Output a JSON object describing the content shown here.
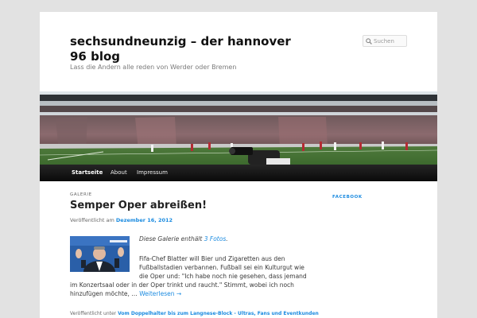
{
  "site": {
    "title": "sechsundneunzig – der hannover 96 blog",
    "description": "Lass die Andern alle reden von Werder oder Bremen"
  },
  "search": {
    "placeholder": "Suchen"
  },
  "nav": {
    "items": [
      {
        "label": "Startseite",
        "active": true
      },
      {
        "label": "About"
      },
      {
        "label": "Impressum"
      }
    ]
  },
  "post": {
    "category": "Galerie",
    "title": "Semper Oper abreißen!",
    "meta_prefix": "Veröffentlicht am",
    "date": "Dezember 16, 2012",
    "gallery_prefix": "Diese Galerie enthält",
    "gallery_link": "3 Fotos",
    "gallery_suffix": ".",
    "excerpt_lines": [
      "Fifa-Chef Blatter will Bier und Zigaretten aus den",
      "Fußballstadien verbannen. Fußball sei ein Kulturgut wie",
      "die Oper und: \"Ich habe noch nie gesehen, dass jemand",
      "im Konzertsaal oder in der Oper trinkt und raucht.\" Stimmt, wobei ich noch"
    ],
    "excerpt_last": "hinzufügen möchte, …",
    "read_more": "Weiterlesen →",
    "footer_prefix": "Veröffentlicht unter",
    "footer_link": "Vom Doppelhalter bis zum Langnese-Block - Ultras, Fans und Eventkunden"
  },
  "sidebar": {
    "widget_title": "Facebook"
  },
  "colors": {
    "accent": "#1b8be0",
    "nav_bg": "#1a1a1a",
    "page_bg": "#e2e2e2"
  }
}
